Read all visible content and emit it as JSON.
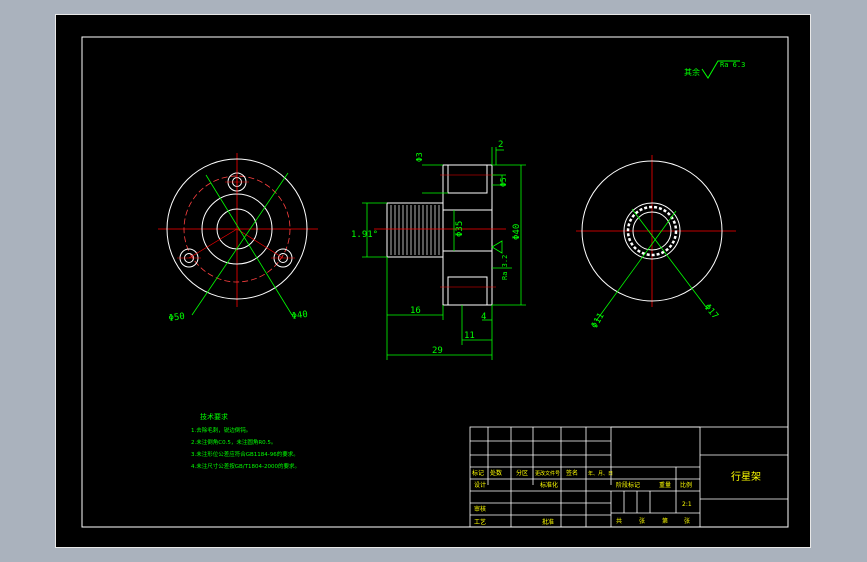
{
  "colors": {
    "background": "#000000",
    "outline": "#ffffff",
    "dimension": "#00ff00",
    "centerline": "#ff0000",
    "hidden": "#ff4040",
    "title_text": "#ffff00"
  },
  "front_view": {
    "dim_left": "Φ50",
    "dim_right": "Φ40"
  },
  "section_view": {
    "dim_top_right": "2",
    "dim_top_left": "Φ3",
    "dim_top_small": "Φ5",
    "dim_center": "Φ35",
    "dim_right": "Φ40",
    "dim_left_angle": "1.91°",
    "roughness": "Ra 3.2",
    "dim_16": "16",
    "dim_4": "4",
    "dim_11": "11",
    "dim_29": "29"
  },
  "side_view": {
    "dim_left": "Φ11",
    "dim_right": "Φ17"
  },
  "roughness_note": {
    "label": "其余",
    "value": "Ra 6.3"
  },
  "technical_requirements": {
    "title": "技术要求",
    "items": [
      "1.去除毛刺，锐边倒钝。",
      "2.未注倒角C0.5，未注圆角R0.5。",
      "3.未注形位公差应符合GB1184-96的要求。",
      "4.未注尺寸公差按GB/T1804-2000的要求。"
    ]
  },
  "title_block": {
    "part_name": "行星架",
    "header_row": [
      "标记",
      "处数",
      "分区",
      "更改文件号",
      "签名",
      "年、月、日"
    ],
    "designer_label": "设计",
    "standardization_label": "标准化",
    "stage_label": "阶段标记",
    "weight_label": "重量",
    "scale_label": "比例",
    "scale_value": "2:1",
    "review_label": "审核",
    "process_label": "工艺",
    "approve_label": "批准",
    "sheet_total_label": "共",
    "sheet_label": "张",
    "sheet_no_label": "第",
    "sheet_end_label": "张"
  }
}
